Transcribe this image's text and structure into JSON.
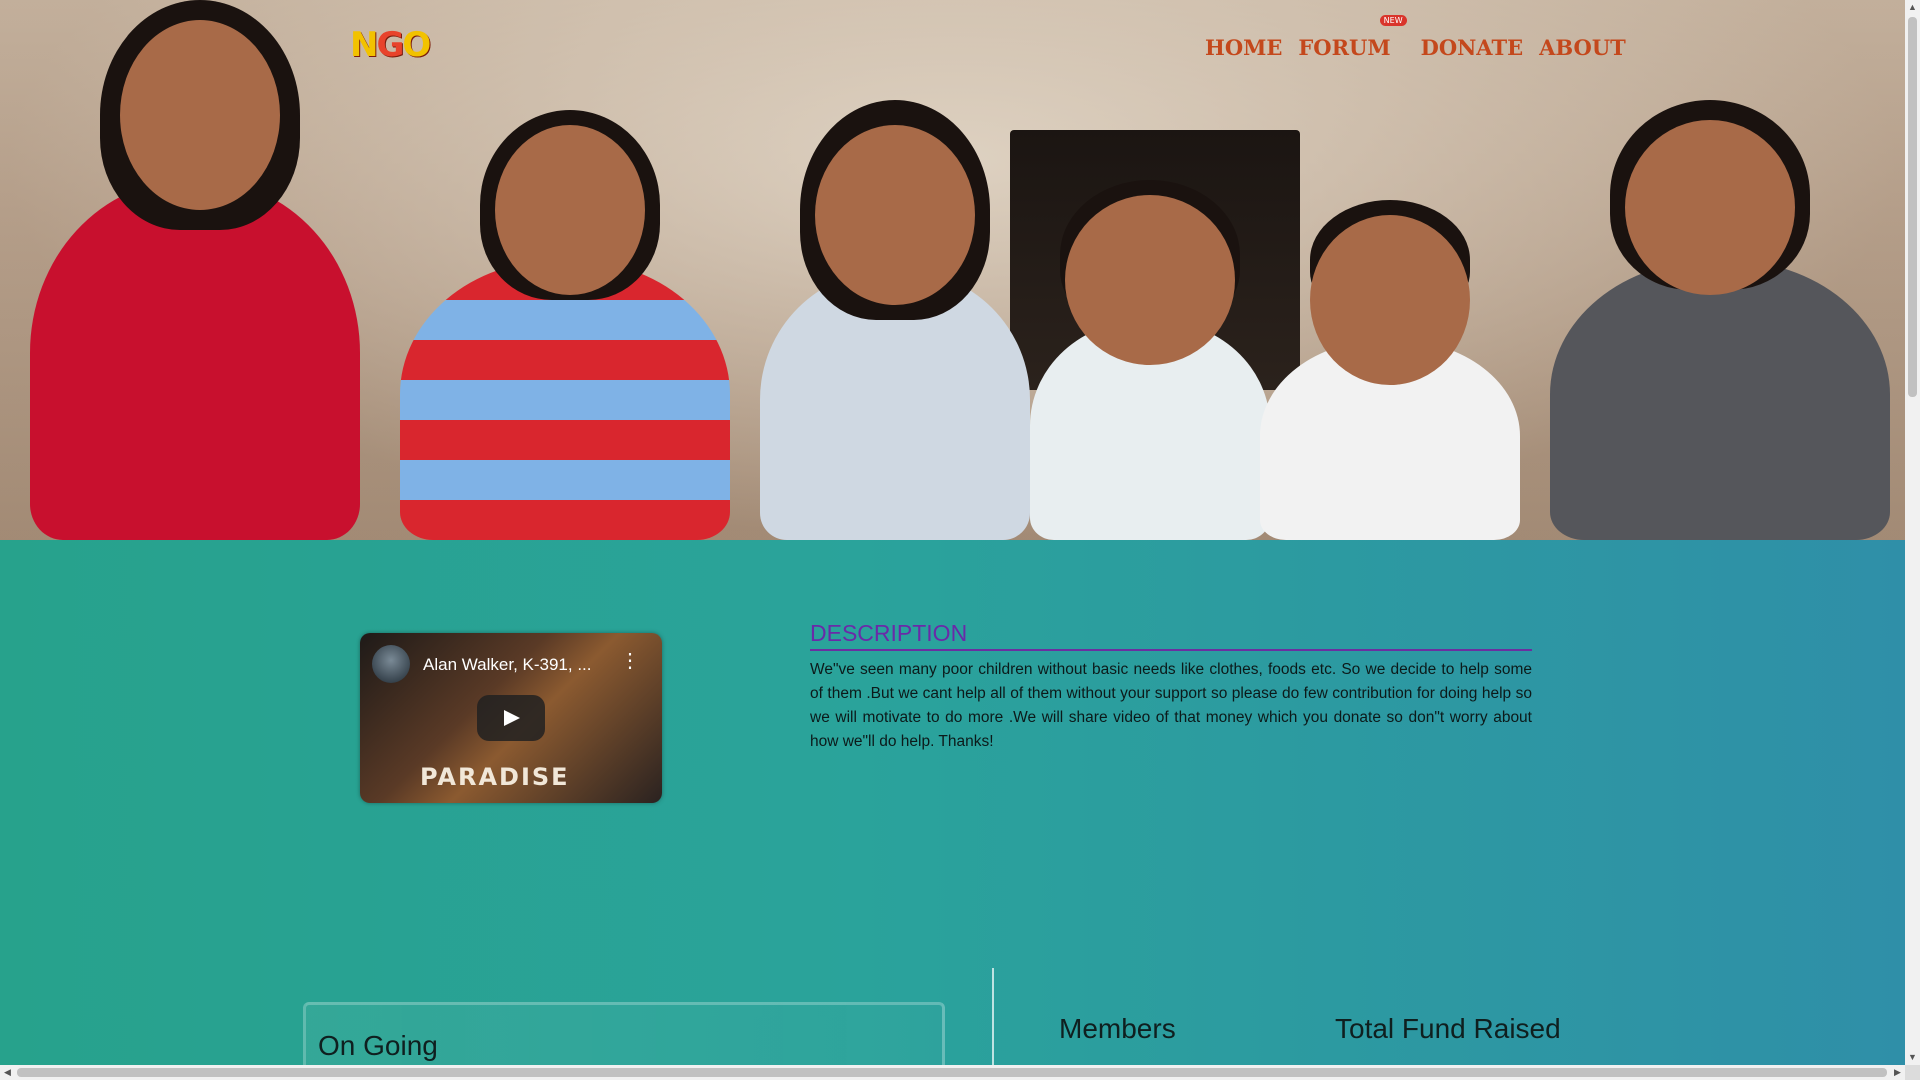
{
  "logo": {
    "text": "NGO"
  },
  "nav": {
    "home": "HOME",
    "forum": "FORUM",
    "forum_badge": "NEW",
    "donate": "DONATE",
    "about": "ABOUT"
  },
  "video": {
    "title": "Alan Walker, K-391, ...",
    "overlay_text": "PARADISE",
    "menu_icon": "⋮"
  },
  "description": {
    "heading": "DESCRIPTION",
    "body": "We\"ve seen many poor children without basic needs like clothes, foods etc. So we decide to help some of them .But we cant help all of them without your support so please do few contribution for doing help so we will motivate to do more .We will share video of that money which you donate so don\"t worry about how we\"ll do help. Thanks!"
  },
  "sections": {
    "ongoing": "On Going",
    "members": "Members",
    "total_fund": "Total Fund Raised"
  },
  "colors": {
    "nav_text": "#c4481c",
    "heading": "#6a2aa8",
    "background": "#2aa39b"
  }
}
